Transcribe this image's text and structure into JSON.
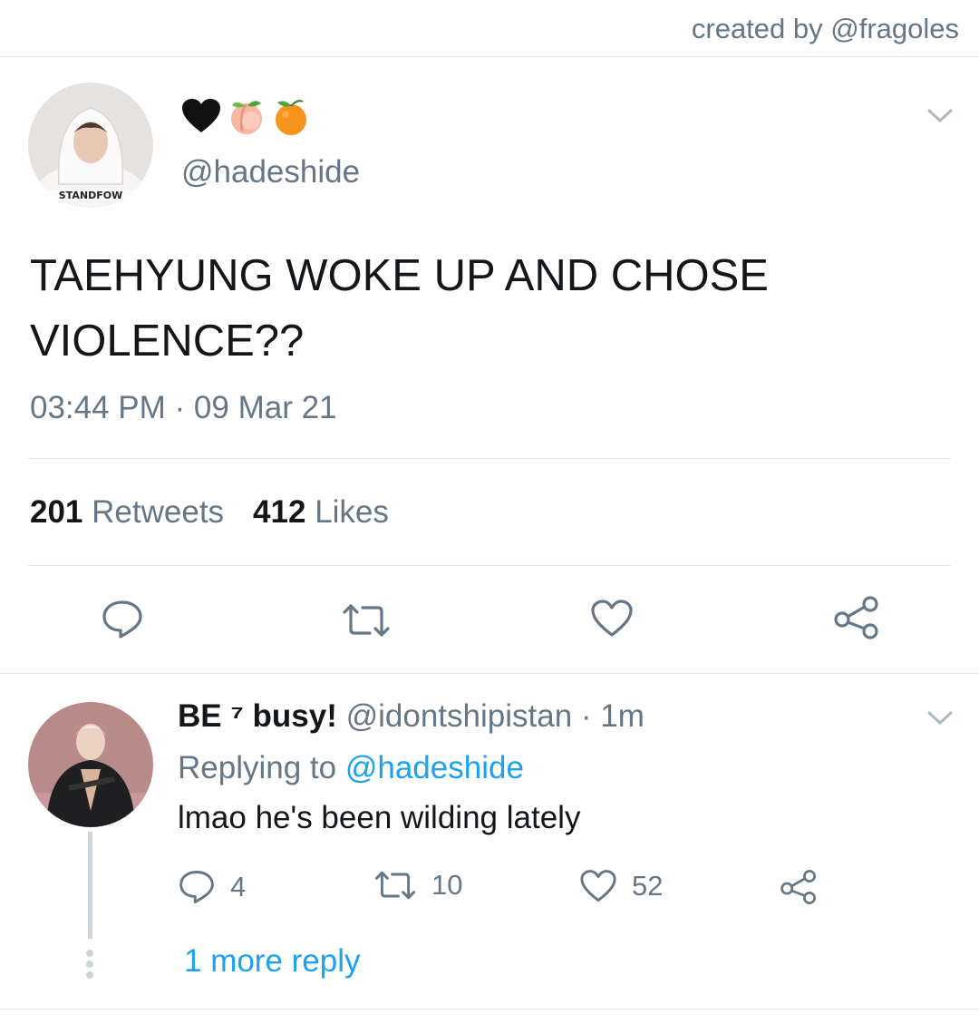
{
  "credit": "created by @fragoles",
  "tweet": {
    "handle": "@hadeshide",
    "name_emojis": [
      "black-heart",
      "peach",
      "tangerine"
    ],
    "text_line1": "TAEHYUNG WOKE UP AND CHOSE",
    "text_line2": "VIOLENCE??",
    "timestamp": "03:44 PM · 09 Mar 21",
    "retweets_count": "201",
    "retweets_label": "Retweets",
    "likes_count": "412",
    "likes_label": "Likes",
    "avatar_caption": "STANDFOW"
  },
  "actions": [
    "reply-icon",
    "retweet-icon",
    "like-icon",
    "share-icon"
  ],
  "reply": {
    "name": "BE ⁷ busy!",
    "handle": "@idontshipistan",
    "time": "· 1m",
    "replying_prefix": "Replying to",
    "replying_to": "@hadeshide",
    "text": "lmao he's been wilding lately",
    "reply_count": "4",
    "retweet_count": "10",
    "like_count": "52",
    "more_replies": "1 more reply"
  },
  "colors": {
    "muted": "#657786",
    "accent": "#1da1f2",
    "text": "#14171a",
    "divider": "#e1e8ed"
  }
}
